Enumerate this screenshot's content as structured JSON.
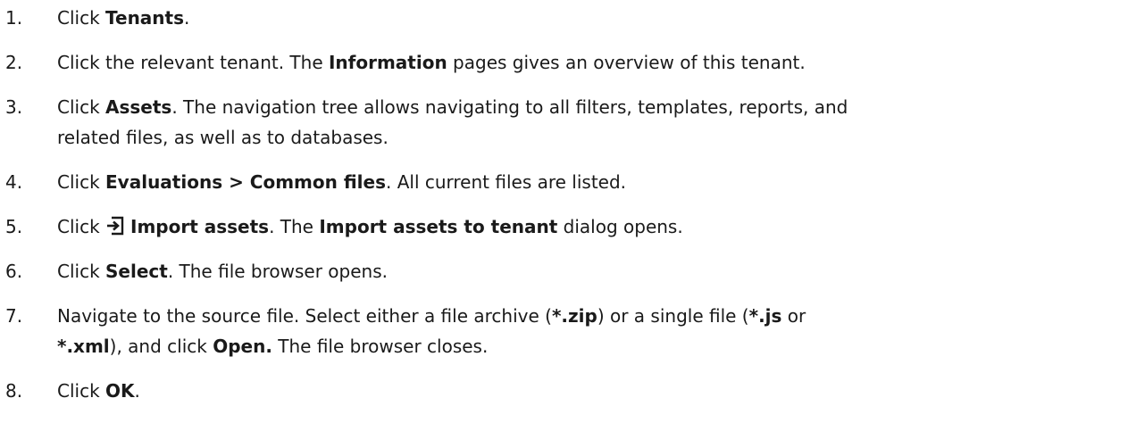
{
  "steps": [
    {
      "number": "1.",
      "parts": [
        "Click ",
        "Tenants",
        "."
      ]
    },
    {
      "number": "2.",
      "parts": [
        "Click the relevant tenant. The ",
        "Information",
        " pages gives an overview of this tenant."
      ]
    },
    {
      "number": "3.",
      "parts": [
        "Click ",
        "Assets",
        ". The navigation tree allows navigating to all filters, templates, reports, and",
        "related files, as well as to databases."
      ]
    },
    {
      "number": "4.",
      "parts": [
        "Click ",
        "Evaluations > Common files",
        ". All current files are listed."
      ]
    },
    {
      "number": "5.",
      "icon": "import-assets-icon",
      "parts": [
        "Click ",
        "Import assets",
        ". The ",
        "Import assets to tenant",
        " dialog opens."
      ]
    },
    {
      "number": "6.",
      "parts": [
        "Click ",
        "Select",
        ". The file browser opens."
      ]
    },
    {
      "number": "7.",
      "parts": [
        "Navigate to the source file. Select either a file archive (",
        "*.zip",
        ") or a single file (",
        "*.js",
        " or",
        "*.xml",
        "), and click ",
        "Open.",
        " The file browser closes."
      ]
    },
    {
      "number": "8.",
      "parts": [
        "Click ",
        "OK",
        "."
      ]
    }
  ]
}
